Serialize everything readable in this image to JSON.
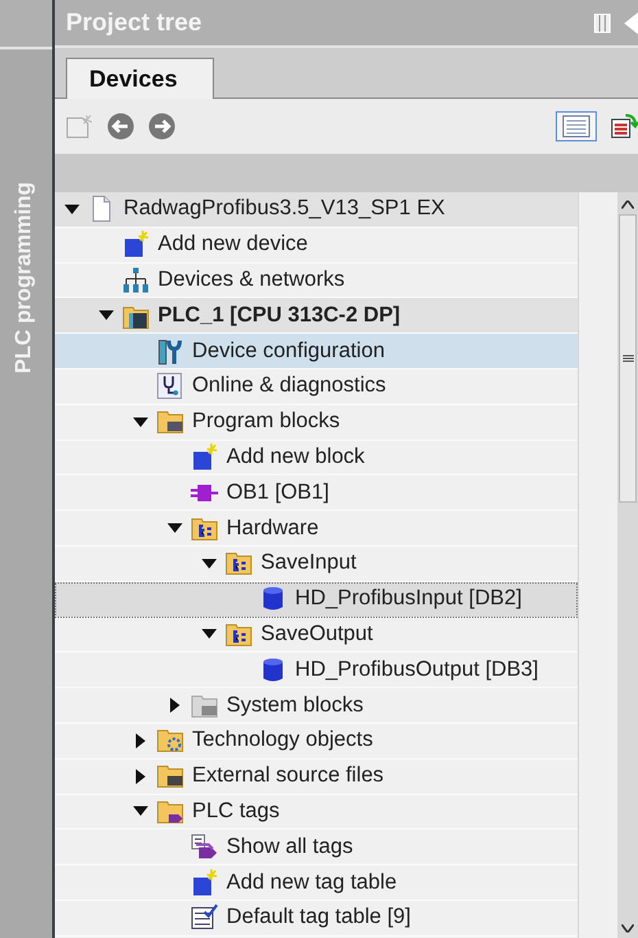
{
  "side_tab": {
    "label": "PLC programming"
  },
  "panel": {
    "title": "Project tree"
  },
  "tabs": [
    {
      "label": "Devices",
      "selected": true
    }
  ],
  "tree": [
    {
      "label": "RadwagProfibus3.5_V13_SP1 EX",
      "kind": "project",
      "expanded": true,
      "selected": false,
      "children": [
        {
          "label": "Add new device",
          "kind": "add",
          "selected": false
        },
        {
          "label": "Devices & networks",
          "kind": "network",
          "selected": false
        },
        {
          "label": "PLC_1 [CPU 313C-2 DP]",
          "kind": "plc",
          "expanded": true,
          "selected": false,
          "children": [
            {
              "label": "Device configuration",
              "kind": "config",
              "selected": true
            },
            {
              "label": "Online & diagnostics",
              "kind": "diagnostics",
              "selected": false
            },
            {
              "label": "Program blocks",
              "kind": "blocks-folder",
              "expanded": true,
              "selected": false,
              "children": [
                {
                  "label": "Add new block",
                  "kind": "add",
                  "selected": false
                },
                {
                  "label": "OB1 [OB1]",
                  "kind": "ob",
                  "selected": false
                },
                {
                  "label": "Hardware",
                  "kind": "group",
                  "expanded": true,
                  "selected": false,
                  "children": [
                    {
                      "label": "SaveInput",
                      "kind": "group",
                      "expanded": true,
                      "selected": false,
                      "children": [
                        {
                          "label": "HD_ProfibusInput [DB2]",
                          "kind": "db",
                          "selected": false,
                          "focused": true
                        }
                      ]
                    },
                    {
                      "label": "SaveOutput",
                      "kind": "group",
                      "expanded": true,
                      "selected": false,
                      "children": [
                        {
                          "label": "HD_ProfibusOutput [DB3]",
                          "kind": "db",
                          "selected": false
                        }
                      ]
                    }
                  ]
                },
                {
                  "label": "System blocks",
                  "kind": "system-folder",
                  "expanded": false,
                  "selected": false
                }
              ]
            },
            {
              "label": "Technology objects",
              "kind": "tech-folder",
              "expanded": false,
              "selected": false
            },
            {
              "label": "External source files",
              "kind": "source-folder",
              "expanded": false,
              "selected": false
            },
            {
              "label": "PLC tags",
              "kind": "tags-folder",
              "expanded": true,
              "selected": false,
              "children": [
                {
                  "label": "Show all tags",
                  "kind": "tags",
                  "selected": false
                },
                {
                  "label": "Add new tag table",
                  "kind": "add",
                  "selected": false
                },
                {
                  "label": "Default tag table [9]",
                  "kind": "tag-table",
                  "selected": false
                }
              ]
            }
          ]
        }
      ]
    }
  ]
}
